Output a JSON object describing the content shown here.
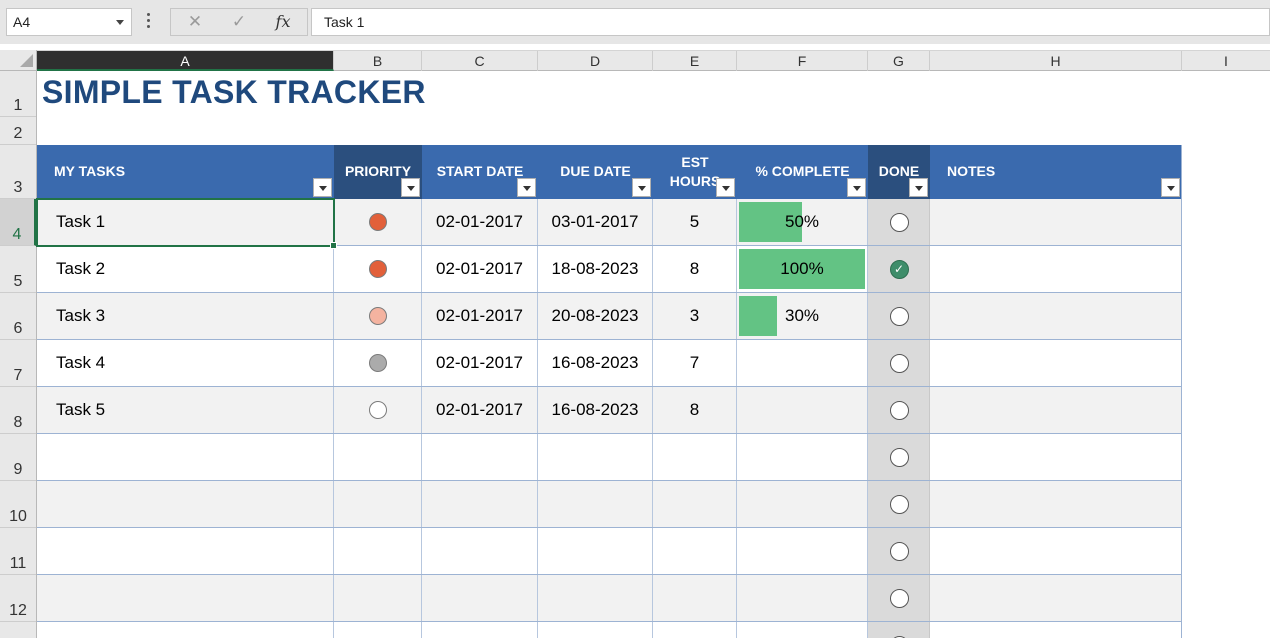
{
  "formula_bar": {
    "name_box": "A4",
    "cancel_icon": "✕",
    "enter_icon": "✓",
    "fx_label": "fx",
    "formula": "Task 1"
  },
  "columns": [
    "A",
    "B",
    "C",
    "D",
    "E",
    "F",
    "G",
    "H",
    "I"
  ],
  "rows": [
    "1",
    "2",
    "3",
    "4",
    "5",
    "6",
    "7",
    "8",
    "9",
    "10",
    "11",
    "12"
  ],
  "sheet": {
    "title": "SIMPLE TASK TRACKER",
    "headers": {
      "tasks": "MY TASKS",
      "priority": "PRIORITY",
      "start": "START DATE",
      "due": "DUE DATE",
      "est_line1": "EST",
      "est_line2": "HOURS",
      "complete": "% COMPLETE",
      "done": "DONE",
      "notes": "NOTES"
    },
    "tasks": [
      {
        "task": "Task 1",
        "priority_color": "#e2603a",
        "start": "02-01-2017",
        "due": "03-01-2017",
        "hours": "5",
        "complete": 0.5,
        "complete_label": "50%",
        "done": false
      },
      {
        "task": "Task 2",
        "priority_color": "#e2603a",
        "start": "02-01-2017",
        "due": "18-08-2023",
        "hours": "8",
        "complete": 1.0,
        "complete_label": "100%",
        "done": true
      },
      {
        "task": "Task 3",
        "priority_color": "#f4b3a0",
        "start": "02-01-2017",
        "due": "20-08-2023",
        "hours": "3",
        "complete": 0.3,
        "complete_label": "30%",
        "done": false
      },
      {
        "task": "Task 4",
        "priority_color": "#ababab",
        "start": "02-01-2017",
        "due": "16-08-2023",
        "hours": "7",
        "complete": null,
        "complete_label": "",
        "done": false
      },
      {
        "task": "Task 5",
        "priority_color": "#ffffff",
        "start": "02-01-2017",
        "due": "16-08-2023",
        "hours": "8",
        "complete": null,
        "complete_label": "",
        "done": false
      }
    ],
    "empty_rows": 5
  },
  "colors": {
    "header_blue": "#3a6aae",
    "header_dark_blue": "#2b4f7e",
    "title": "#1f497d",
    "progress_green": "#63c384",
    "selection_green": "#217346"
  }
}
